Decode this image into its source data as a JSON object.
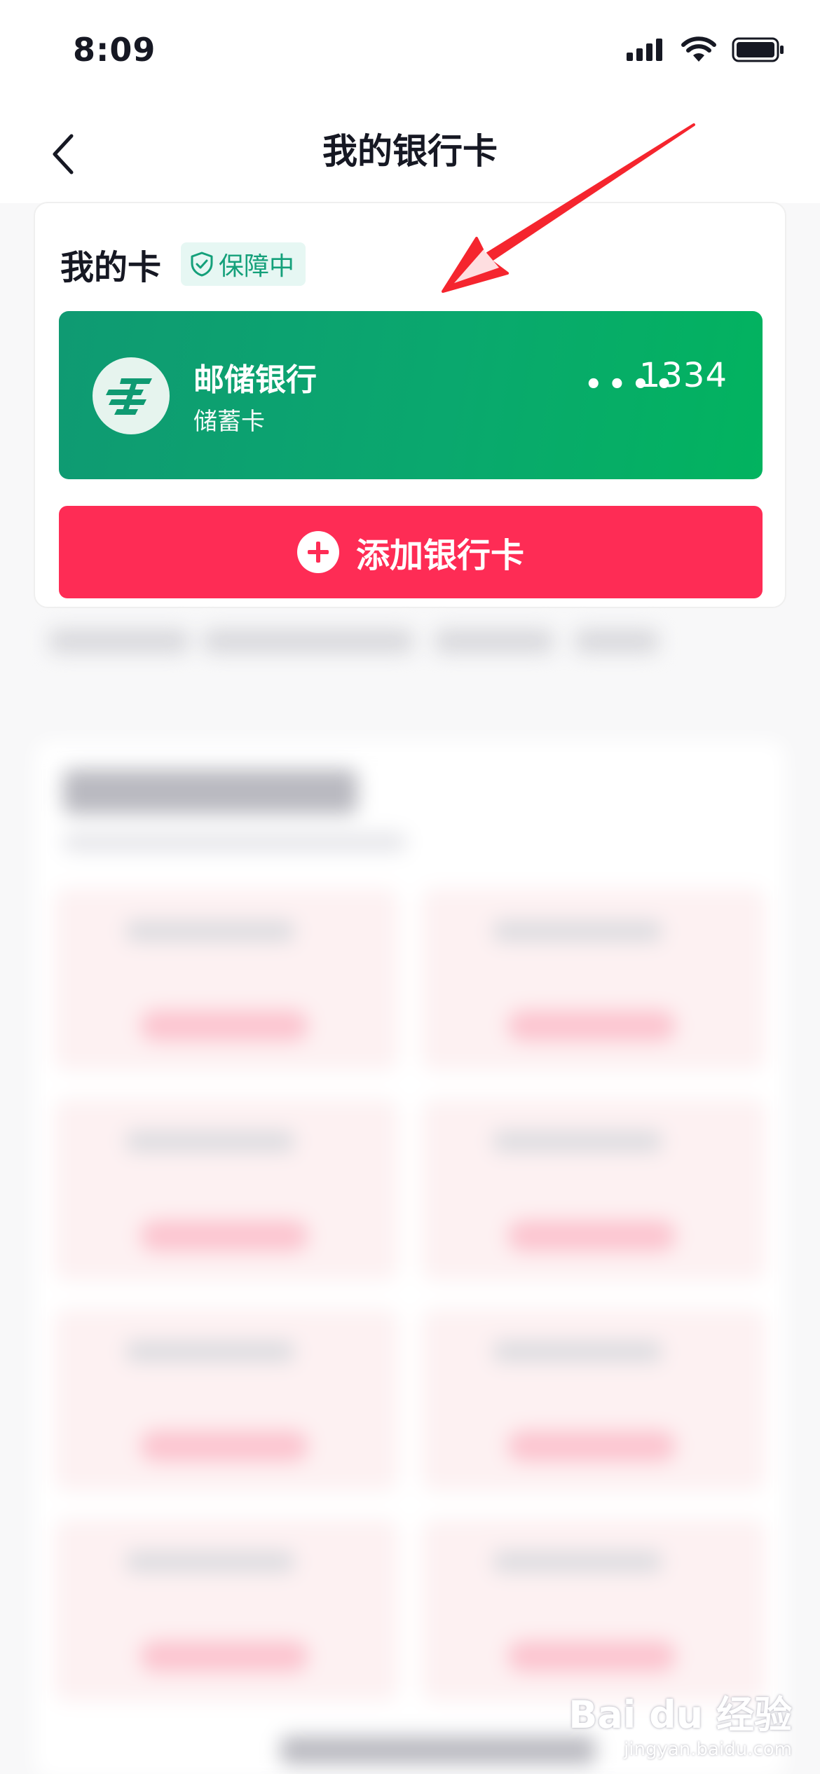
{
  "status_bar": {
    "time": "8:09",
    "icons": [
      "cellular-signal-icon",
      "wifi-icon",
      "battery-icon"
    ]
  },
  "nav": {
    "title": "我的银行卡",
    "back_icon": "chevron-left-icon"
  },
  "my_cards": {
    "title": "我的卡",
    "badge_label": "保障中",
    "badge_icon": "shield-check-icon",
    "card": {
      "bank_name": "邮储银行",
      "card_type": "储蓄卡",
      "masked": "••••",
      "last4": "1334",
      "logo_icon": "postal-savings-bank-logo-icon"
    },
    "add_button_label": "添加银行卡",
    "add_icon": "plus-circle-icon"
  },
  "watermark": {
    "logo_text": "Bai du 经验",
    "url_text": "jingyan.baidu.com"
  },
  "colors": {
    "card_green": "#0aa86e",
    "add_red": "#fe2c55",
    "badge_green": "#14a07a",
    "arrow_red": "#f5252e"
  }
}
